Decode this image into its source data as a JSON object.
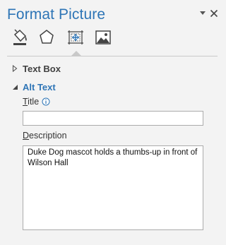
{
  "pane": {
    "title": "Format Picture"
  },
  "tabs": [
    {
      "icon": "fill-line-icon"
    },
    {
      "icon": "effects-pentagon-icon"
    },
    {
      "icon": "size-properties-icon",
      "selected": true
    },
    {
      "icon": "picture-icon"
    }
  ],
  "sections": {
    "textbox": {
      "label": "Text Box",
      "expanded": false
    },
    "alttext": {
      "label": "Alt Text",
      "expanded": true
    }
  },
  "alt_text": {
    "title_label_access": "T",
    "title_label_rest": "itle",
    "title_value": "",
    "description_label_access": "D",
    "description_label_rest": "escription",
    "description_value": "Duke Dog mascot holds a thumbs-up in front of Wilson Hall"
  },
  "colors": {
    "accent": "#2e75b6",
    "background": "#f3f3f3"
  }
}
